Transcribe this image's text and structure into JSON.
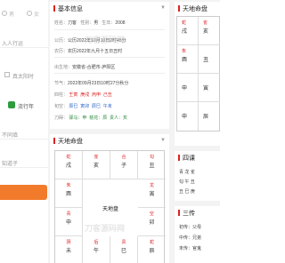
{
  "form": {
    "gender_male": "男",
    "gender_female": "女",
    "name_placeholder": "入人行运",
    "solar_time_label": "真太阳时",
    "toggle_label": "流行年",
    "field4": "不同填",
    "field5": "知道子"
  },
  "basic": {
    "title": "基本信息",
    "name_label": "姓名：",
    "name_value": "刀客",
    "sex_label": "性别：",
    "sex_value": "男",
    "birth_label": "生年：",
    "birth_value": "2008",
    "solar_label": "公历：",
    "solar_value": "公历2022年10月10日2时45分",
    "lunar_label": "农历：",
    "lunar_value": "农历2022年九月十五日丑时",
    "place_label": "出生地：",
    "place_value": "安徽省-合肥市-庐阳区",
    "jieqi_label": "节气：",
    "jieqi_value": "2022年09月23日10时27分秋分",
    "sizhu_label": "四柱：",
    "sizhu_values": [
      "壬寅",
      "庚戌",
      "丙申",
      "己丑"
    ],
    "xunkong_label": "旬空：",
    "xunkong_values": [
      "辰巳",
      "寅卯",
      "辰巳",
      "午未"
    ],
    "shaji_label": "刀碍：",
    "shaji_values": [
      "驿马：申",
      "桃花：辰",
      "贵人：亥"
    ]
  },
  "tiandi": {
    "title": "天地命盘",
    "center": "天地盘",
    "top": [
      [
        "蛇",
        "戌"
      ],
      [
        "雀",
        "亥"
      ],
      [
        "合",
        "子"
      ],
      [
        "勾",
        "丑"
      ]
    ],
    "left": [
      [
        "朱",
        "酉"
      ],
      [
        "青",
        "申"
      ]
    ],
    "right": [
      [
        "龙",
        "寅"
      ],
      [
        "空",
        "卯"
      ]
    ],
    "bottom": [
      [
        "阴",
        "未"
      ],
      [
        "后",
        "午"
      ],
      [
        "贵",
        "巳"
      ],
      [
        "蛇",
        "辰"
      ]
    ],
    "side_left": "东面",
    "side_right": "寅"
  },
  "right_panel": {
    "tiandi_title": "天地命盘",
    "cells": [
      [
        "蛇",
        "戌"
      ],
      [
        "雀",
        "亥"
      ],
      [
        "朱",
        "酉"
      ],
      [
        "",
        "申"
      ],
      [
        "",
        "丑"
      ],
      [
        "",
        "寅"
      ],
      [
        "",
        "申"
      ],
      [
        "",
        "辰"
      ]
    ],
    "siker_title": "四课",
    "siker_rows": [
      [
        "青",
        "龙",
        "雀"
      ],
      [
        "勾",
        "午",
        "丑"
      ],
      [
        "丑",
        "巳",
        "庚"
      ]
    ],
    "sanchuan_title": "三传",
    "sanchuan_rows": [
      "初传：父母",
      "中传：兄弟",
      "末传：官鬼"
    ]
  },
  "watermark": "刀客源码网"
}
